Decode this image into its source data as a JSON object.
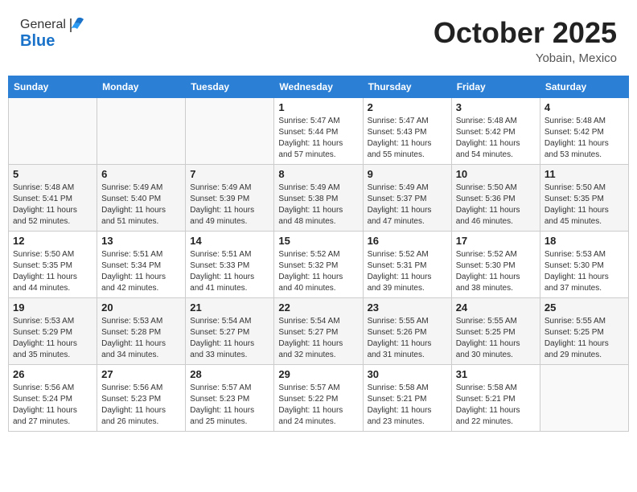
{
  "header": {
    "logo_line1": "General",
    "logo_line2": "Blue",
    "month_title": "October 2025",
    "location": "Yobain, Mexico"
  },
  "calendar": {
    "weekdays": [
      "Sunday",
      "Monday",
      "Tuesday",
      "Wednesday",
      "Thursday",
      "Friday",
      "Saturday"
    ],
    "weeks": [
      [
        {
          "day": "",
          "info": ""
        },
        {
          "day": "",
          "info": ""
        },
        {
          "day": "",
          "info": ""
        },
        {
          "day": "1",
          "info": "Sunrise: 5:47 AM\nSunset: 5:44 PM\nDaylight: 11 hours\nand 57 minutes."
        },
        {
          "day": "2",
          "info": "Sunrise: 5:47 AM\nSunset: 5:43 PM\nDaylight: 11 hours\nand 55 minutes."
        },
        {
          "day": "3",
          "info": "Sunrise: 5:48 AM\nSunset: 5:42 PM\nDaylight: 11 hours\nand 54 minutes."
        },
        {
          "day": "4",
          "info": "Sunrise: 5:48 AM\nSunset: 5:42 PM\nDaylight: 11 hours\nand 53 minutes."
        }
      ],
      [
        {
          "day": "5",
          "info": "Sunrise: 5:48 AM\nSunset: 5:41 PM\nDaylight: 11 hours\nand 52 minutes."
        },
        {
          "day": "6",
          "info": "Sunrise: 5:49 AM\nSunset: 5:40 PM\nDaylight: 11 hours\nand 51 minutes."
        },
        {
          "day": "7",
          "info": "Sunrise: 5:49 AM\nSunset: 5:39 PM\nDaylight: 11 hours\nand 49 minutes."
        },
        {
          "day": "8",
          "info": "Sunrise: 5:49 AM\nSunset: 5:38 PM\nDaylight: 11 hours\nand 48 minutes."
        },
        {
          "day": "9",
          "info": "Sunrise: 5:49 AM\nSunset: 5:37 PM\nDaylight: 11 hours\nand 47 minutes."
        },
        {
          "day": "10",
          "info": "Sunrise: 5:50 AM\nSunset: 5:36 PM\nDaylight: 11 hours\nand 46 minutes."
        },
        {
          "day": "11",
          "info": "Sunrise: 5:50 AM\nSunset: 5:35 PM\nDaylight: 11 hours\nand 45 minutes."
        }
      ],
      [
        {
          "day": "12",
          "info": "Sunrise: 5:50 AM\nSunset: 5:35 PM\nDaylight: 11 hours\nand 44 minutes."
        },
        {
          "day": "13",
          "info": "Sunrise: 5:51 AM\nSunset: 5:34 PM\nDaylight: 11 hours\nand 42 minutes."
        },
        {
          "day": "14",
          "info": "Sunrise: 5:51 AM\nSunset: 5:33 PM\nDaylight: 11 hours\nand 41 minutes."
        },
        {
          "day": "15",
          "info": "Sunrise: 5:52 AM\nSunset: 5:32 PM\nDaylight: 11 hours\nand 40 minutes."
        },
        {
          "day": "16",
          "info": "Sunrise: 5:52 AM\nSunset: 5:31 PM\nDaylight: 11 hours\nand 39 minutes."
        },
        {
          "day": "17",
          "info": "Sunrise: 5:52 AM\nSunset: 5:30 PM\nDaylight: 11 hours\nand 38 minutes."
        },
        {
          "day": "18",
          "info": "Sunrise: 5:53 AM\nSunset: 5:30 PM\nDaylight: 11 hours\nand 37 minutes."
        }
      ],
      [
        {
          "day": "19",
          "info": "Sunrise: 5:53 AM\nSunset: 5:29 PM\nDaylight: 11 hours\nand 35 minutes."
        },
        {
          "day": "20",
          "info": "Sunrise: 5:53 AM\nSunset: 5:28 PM\nDaylight: 11 hours\nand 34 minutes."
        },
        {
          "day": "21",
          "info": "Sunrise: 5:54 AM\nSunset: 5:27 PM\nDaylight: 11 hours\nand 33 minutes."
        },
        {
          "day": "22",
          "info": "Sunrise: 5:54 AM\nSunset: 5:27 PM\nDaylight: 11 hours\nand 32 minutes."
        },
        {
          "day": "23",
          "info": "Sunrise: 5:55 AM\nSunset: 5:26 PM\nDaylight: 11 hours\nand 31 minutes."
        },
        {
          "day": "24",
          "info": "Sunrise: 5:55 AM\nSunset: 5:25 PM\nDaylight: 11 hours\nand 30 minutes."
        },
        {
          "day": "25",
          "info": "Sunrise: 5:55 AM\nSunset: 5:25 PM\nDaylight: 11 hours\nand 29 minutes."
        }
      ],
      [
        {
          "day": "26",
          "info": "Sunrise: 5:56 AM\nSunset: 5:24 PM\nDaylight: 11 hours\nand 27 minutes."
        },
        {
          "day": "27",
          "info": "Sunrise: 5:56 AM\nSunset: 5:23 PM\nDaylight: 11 hours\nand 26 minutes."
        },
        {
          "day": "28",
          "info": "Sunrise: 5:57 AM\nSunset: 5:23 PM\nDaylight: 11 hours\nand 25 minutes."
        },
        {
          "day": "29",
          "info": "Sunrise: 5:57 AM\nSunset: 5:22 PM\nDaylight: 11 hours\nand 24 minutes."
        },
        {
          "day": "30",
          "info": "Sunrise: 5:58 AM\nSunset: 5:21 PM\nDaylight: 11 hours\nand 23 minutes."
        },
        {
          "day": "31",
          "info": "Sunrise: 5:58 AM\nSunset: 5:21 PM\nDaylight: 11 hours\nand 22 minutes."
        },
        {
          "day": "",
          "info": ""
        }
      ]
    ]
  }
}
